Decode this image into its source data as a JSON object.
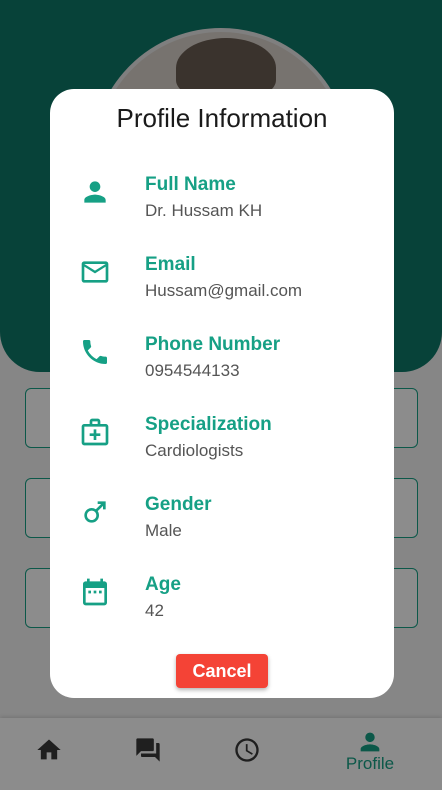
{
  "dialog": {
    "title": "Profile Information",
    "fields": [
      {
        "icon": "person-icon",
        "label": "Full Name",
        "value": "Dr. Hussam KH"
      },
      {
        "icon": "email-icon",
        "label": "Email",
        "value": "Hussam@gmail.com"
      },
      {
        "icon": "phone-icon",
        "label": "Phone Number",
        "value": "0954544133"
      },
      {
        "icon": "medical-bag-icon",
        "label": "Specialization",
        "value": "Cardiologists"
      },
      {
        "icon": "male-icon",
        "label": "Gender",
        "value": "Male"
      },
      {
        "icon": "calendar-icon",
        "label": "Age",
        "value": "42"
      }
    ],
    "cancel_label": "Cancel"
  },
  "bottom_nav": {
    "items": [
      {
        "icon": "home-icon"
      },
      {
        "icon": "chat-icon"
      },
      {
        "icon": "clock-icon"
      },
      {
        "icon": "person-icon",
        "label": "Profile",
        "active": true
      }
    ]
  },
  "colors": {
    "accent": "#16a085",
    "header": "#0e7868",
    "cancel": "#f44336"
  }
}
